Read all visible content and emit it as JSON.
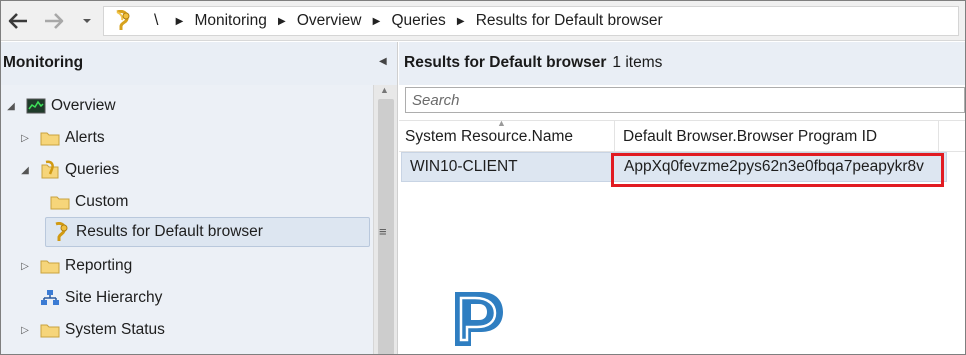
{
  "address_bar": {
    "root_separator": "\\",
    "breadcrumbs": [
      "Monitoring",
      "Overview",
      "Queries",
      "Results for Default browser"
    ]
  },
  "left_pane": {
    "title": "Monitoring",
    "tree": [
      {
        "label": "Overview",
        "icon": "monitor-chart-icon",
        "expander": "expanded"
      },
      {
        "label": "Alerts",
        "icon": "folder-icon",
        "expander": "collapsed"
      },
      {
        "label": "Queries",
        "icon": "query-folder-icon",
        "expander": "expanded"
      },
      {
        "label": "Custom",
        "icon": "folder-icon",
        "expander": "none"
      },
      {
        "label": "Results for Default browser",
        "icon": "query-result-icon",
        "expander": "none",
        "selected": true
      },
      {
        "label": "Reporting",
        "icon": "folder-icon",
        "expander": "collapsed"
      },
      {
        "label": "Site Hierarchy",
        "icon": "site-hierarchy-icon",
        "expander": "none"
      },
      {
        "label": "System Status",
        "icon": "folder-icon",
        "expander": "collapsed"
      }
    ]
  },
  "right_pane": {
    "title": "Results for Default browser",
    "count": "1 items",
    "search_placeholder": "Search",
    "columns": [
      "System Resource.Name",
      "Default Browser.Browser Program ID"
    ],
    "rows": [
      [
        "WIN10-CLIENT",
        "AppXq0fevzme2pys62n3e0fbqa7peapykr8v"
      ]
    ]
  },
  "colors": {
    "highlight_box": "#e11b22",
    "pane_header": "#e9eef5",
    "selection": "#dde6f1"
  }
}
